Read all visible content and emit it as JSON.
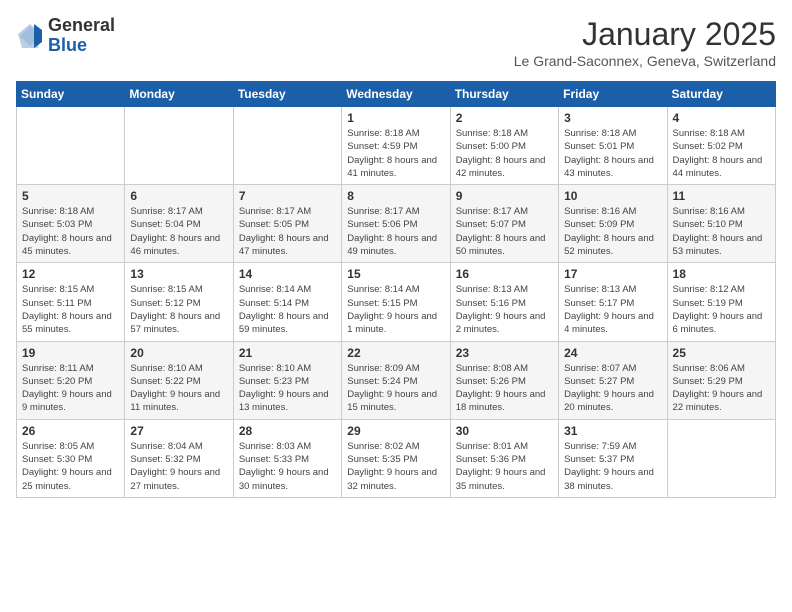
{
  "logo": {
    "general": "General",
    "blue": "Blue"
  },
  "header": {
    "month": "January 2025",
    "location": "Le Grand-Saconnex, Geneva, Switzerland"
  },
  "weekdays": [
    "Sunday",
    "Monday",
    "Tuesday",
    "Wednesday",
    "Thursday",
    "Friday",
    "Saturday"
  ],
  "weeks": [
    [
      {
        "day": "",
        "sunrise": "",
        "sunset": "",
        "daylight": ""
      },
      {
        "day": "",
        "sunrise": "",
        "sunset": "",
        "daylight": ""
      },
      {
        "day": "",
        "sunrise": "",
        "sunset": "",
        "daylight": ""
      },
      {
        "day": "1",
        "sunrise": "Sunrise: 8:18 AM",
        "sunset": "Sunset: 4:59 PM",
        "daylight": "Daylight: 8 hours and 41 minutes."
      },
      {
        "day": "2",
        "sunrise": "Sunrise: 8:18 AM",
        "sunset": "Sunset: 5:00 PM",
        "daylight": "Daylight: 8 hours and 42 minutes."
      },
      {
        "day": "3",
        "sunrise": "Sunrise: 8:18 AM",
        "sunset": "Sunset: 5:01 PM",
        "daylight": "Daylight: 8 hours and 43 minutes."
      },
      {
        "day": "4",
        "sunrise": "Sunrise: 8:18 AM",
        "sunset": "Sunset: 5:02 PM",
        "daylight": "Daylight: 8 hours and 44 minutes."
      }
    ],
    [
      {
        "day": "5",
        "sunrise": "Sunrise: 8:18 AM",
        "sunset": "Sunset: 5:03 PM",
        "daylight": "Daylight: 8 hours and 45 minutes."
      },
      {
        "day": "6",
        "sunrise": "Sunrise: 8:17 AM",
        "sunset": "Sunset: 5:04 PM",
        "daylight": "Daylight: 8 hours and 46 minutes."
      },
      {
        "day": "7",
        "sunrise": "Sunrise: 8:17 AM",
        "sunset": "Sunset: 5:05 PM",
        "daylight": "Daylight: 8 hours and 47 minutes."
      },
      {
        "day": "8",
        "sunrise": "Sunrise: 8:17 AM",
        "sunset": "Sunset: 5:06 PM",
        "daylight": "Daylight: 8 hours and 49 minutes."
      },
      {
        "day": "9",
        "sunrise": "Sunrise: 8:17 AM",
        "sunset": "Sunset: 5:07 PM",
        "daylight": "Daylight: 8 hours and 50 minutes."
      },
      {
        "day": "10",
        "sunrise": "Sunrise: 8:16 AM",
        "sunset": "Sunset: 5:09 PM",
        "daylight": "Daylight: 8 hours and 52 minutes."
      },
      {
        "day": "11",
        "sunrise": "Sunrise: 8:16 AM",
        "sunset": "Sunset: 5:10 PM",
        "daylight": "Daylight: 8 hours and 53 minutes."
      }
    ],
    [
      {
        "day": "12",
        "sunrise": "Sunrise: 8:15 AM",
        "sunset": "Sunset: 5:11 PM",
        "daylight": "Daylight: 8 hours and 55 minutes."
      },
      {
        "day": "13",
        "sunrise": "Sunrise: 8:15 AM",
        "sunset": "Sunset: 5:12 PM",
        "daylight": "Daylight: 8 hours and 57 minutes."
      },
      {
        "day": "14",
        "sunrise": "Sunrise: 8:14 AM",
        "sunset": "Sunset: 5:14 PM",
        "daylight": "Daylight: 8 hours and 59 minutes."
      },
      {
        "day": "15",
        "sunrise": "Sunrise: 8:14 AM",
        "sunset": "Sunset: 5:15 PM",
        "daylight": "Daylight: 9 hours and 1 minute."
      },
      {
        "day": "16",
        "sunrise": "Sunrise: 8:13 AM",
        "sunset": "Sunset: 5:16 PM",
        "daylight": "Daylight: 9 hours and 2 minutes."
      },
      {
        "day": "17",
        "sunrise": "Sunrise: 8:13 AM",
        "sunset": "Sunset: 5:17 PM",
        "daylight": "Daylight: 9 hours and 4 minutes."
      },
      {
        "day": "18",
        "sunrise": "Sunrise: 8:12 AM",
        "sunset": "Sunset: 5:19 PM",
        "daylight": "Daylight: 9 hours and 6 minutes."
      }
    ],
    [
      {
        "day": "19",
        "sunrise": "Sunrise: 8:11 AM",
        "sunset": "Sunset: 5:20 PM",
        "daylight": "Daylight: 9 hours and 9 minutes."
      },
      {
        "day": "20",
        "sunrise": "Sunrise: 8:10 AM",
        "sunset": "Sunset: 5:22 PM",
        "daylight": "Daylight: 9 hours and 11 minutes."
      },
      {
        "day": "21",
        "sunrise": "Sunrise: 8:10 AM",
        "sunset": "Sunset: 5:23 PM",
        "daylight": "Daylight: 9 hours and 13 minutes."
      },
      {
        "day": "22",
        "sunrise": "Sunrise: 8:09 AM",
        "sunset": "Sunset: 5:24 PM",
        "daylight": "Daylight: 9 hours and 15 minutes."
      },
      {
        "day": "23",
        "sunrise": "Sunrise: 8:08 AM",
        "sunset": "Sunset: 5:26 PM",
        "daylight": "Daylight: 9 hours and 18 minutes."
      },
      {
        "day": "24",
        "sunrise": "Sunrise: 8:07 AM",
        "sunset": "Sunset: 5:27 PM",
        "daylight": "Daylight: 9 hours and 20 minutes."
      },
      {
        "day": "25",
        "sunrise": "Sunrise: 8:06 AM",
        "sunset": "Sunset: 5:29 PM",
        "daylight": "Daylight: 9 hours and 22 minutes."
      }
    ],
    [
      {
        "day": "26",
        "sunrise": "Sunrise: 8:05 AM",
        "sunset": "Sunset: 5:30 PM",
        "daylight": "Daylight: 9 hours and 25 minutes."
      },
      {
        "day": "27",
        "sunrise": "Sunrise: 8:04 AM",
        "sunset": "Sunset: 5:32 PM",
        "daylight": "Daylight: 9 hours and 27 minutes."
      },
      {
        "day": "28",
        "sunrise": "Sunrise: 8:03 AM",
        "sunset": "Sunset: 5:33 PM",
        "daylight": "Daylight: 9 hours and 30 minutes."
      },
      {
        "day": "29",
        "sunrise": "Sunrise: 8:02 AM",
        "sunset": "Sunset: 5:35 PM",
        "daylight": "Daylight: 9 hours and 32 minutes."
      },
      {
        "day": "30",
        "sunrise": "Sunrise: 8:01 AM",
        "sunset": "Sunset: 5:36 PM",
        "daylight": "Daylight: 9 hours and 35 minutes."
      },
      {
        "day": "31",
        "sunrise": "Sunrise: 7:59 AM",
        "sunset": "Sunset: 5:37 PM",
        "daylight": "Daylight: 9 hours and 38 minutes."
      },
      {
        "day": "",
        "sunrise": "",
        "sunset": "",
        "daylight": ""
      }
    ]
  ]
}
